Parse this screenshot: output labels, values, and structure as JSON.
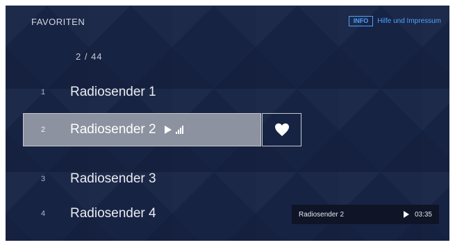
{
  "header": {
    "title": "FAVORITEN",
    "info_badge": "INFO",
    "info_text": "Hilfe und Impressum"
  },
  "list": {
    "page_indicator": "2 / 44",
    "selected_index": 2,
    "items": [
      {
        "number": "1",
        "name": "Radiosender 1"
      },
      {
        "number": "2",
        "name": "Radiosender 2"
      },
      {
        "number": "3",
        "name": "Radiosender 3"
      },
      {
        "number": "4",
        "name": "Radiosender 4"
      }
    ]
  },
  "favorite_button": {
    "icon": "heart-icon",
    "active": true
  },
  "now_playing": {
    "station": "Radiosender 2",
    "time": "03:35",
    "icon": "play-icon"
  },
  "colors": {
    "background": "#172343",
    "selected_row": "#8c929f",
    "accent": "#4aa3ff",
    "now_playing_bg": "#0f1526"
  }
}
